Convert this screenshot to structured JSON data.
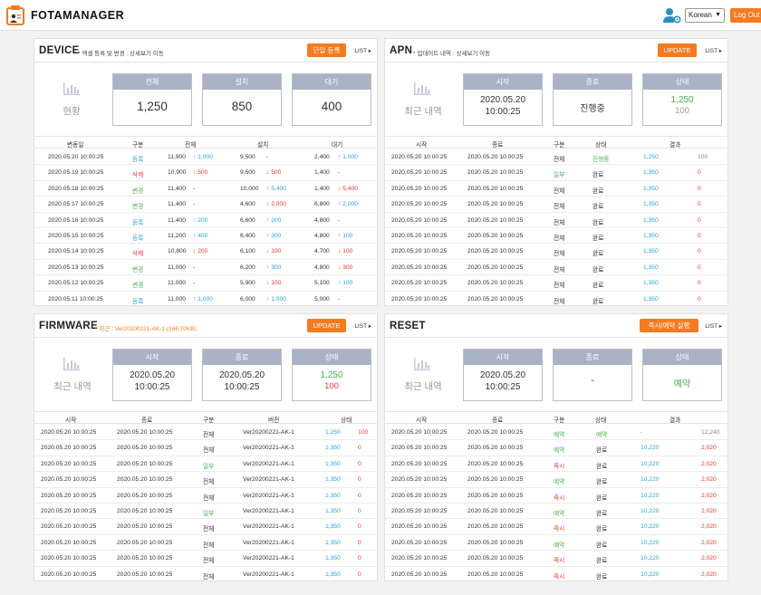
{
  "header": {
    "brand": "FOTAMANAGER",
    "lang": "Korean",
    "logout": "Log Out",
    "colors": {
      "accent": "#f57b20",
      "box_header": "#a9b3c5",
      "blue": "#2aa4d6",
      "red": "#e53935",
      "green": "#4caf50"
    }
  },
  "device": {
    "title": "DEVICE",
    "subtitle": "* 엑셀 등록 및 변경 : 상세보기 이동",
    "button": "단일 등록",
    "list": "LIST ▸",
    "summary_label": "현황",
    "boxes": [
      {
        "label": "전체",
        "value": "1,250"
      },
      {
        "label": "설치",
        "value": "850"
      },
      {
        "label": "대기",
        "value": "400"
      }
    ],
    "columns": [
      "변동일",
      "구분",
      "전체",
      "설치",
      "대기"
    ],
    "rows": [
      {
        "date": "2020.05.20 10:00:25",
        "type": "등록",
        "tc": "b",
        "total": "11,900",
        "td": "↑ 1,000",
        "tdc": "b",
        "inst": "9,500",
        "idl": "-",
        "idc": "n",
        "wait": "2,400",
        "wd": "↑ 1,000",
        "wdc": "b"
      },
      {
        "date": "2020.05.19 10:00:25",
        "type": "삭제",
        "tc": "r",
        "total": "10,900",
        "td": "↓ 500",
        "tdc": "r",
        "inst": "9,500",
        "idl": "↓ 500",
        "idc": "r",
        "wait": "1,400",
        "wd": "-",
        "wdc": "n"
      },
      {
        "date": "2020.05.18 10:00:25",
        "type": "변경",
        "tc": "g",
        "total": "11,400",
        "td": "-",
        "tdc": "n",
        "inst": "10,000",
        "idl": "↑ 5,400",
        "idc": "b",
        "wait": "1,400",
        "wd": "↓ 5,400",
        "wdc": "r"
      },
      {
        "date": "2020.05.17 10:00:25",
        "type": "변경",
        "tc": "g",
        "total": "11,400",
        "td": "-",
        "tdc": "n",
        "inst": "4,600",
        "idl": "↓ 2,000",
        "idc": "r",
        "wait": "6,800",
        "wd": "↑ 2,000",
        "wdc": "b"
      },
      {
        "date": "2020.05.16 10:00:25",
        "type": "등록",
        "tc": "b",
        "total": "11,400",
        "td": "↑ 200",
        "tdc": "b",
        "inst": "6,600",
        "idl": "↑ 200",
        "idc": "b",
        "wait": "4,800",
        "wd": "-",
        "wdc": "n"
      },
      {
        "date": "2020.05.15 10:00:25",
        "type": "등록",
        "tc": "b",
        "total": "11,200",
        "td": "↑ 400",
        "tdc": "b",
        "inst": "6,400",
        "idl": "↑ 300",
        "idc": "b",
        "wait": "4,800",
        "wd": "↑ 100",
        "wdc": "b"
      },
      {
        "date": "2020.05.14 10:00:25",
        "type": "삭제",
        "tc": "r",
        "total": "10,800",
        "td": "↓ 200",
        "tdc": "r",
        "inst": "6,100",
        "idl": "↓ 100",
        "idc": "r",
        "wait": "4,700",
        "wd": "↓ 100",
        "wdc": "r"
      },
      {
        "date": "2020.05.13 10:00:25",
        "type": "변경",
        "tc": "g",
        "total": "11,000",
        "td": "-",
        "tdc": "n",
        "inst": "6,200",
        "idl": "↑ 300",
        "idc": "b",
        "wait": "4,800",
        "wd": "↓ 300",
        "wdc": "r"
      },
      {
        "date": "2020.05.12 10:00:25",
        "type": "변경",
        "tc": "g",
        "total": "11,000",
        "td": "-",
        "tdc": "n",
        "inst": "5,900",
        "idl": "↓ 100",
        "idc": "r",
        "wait": "5,100",
        "wd": "↑ 100",
        "wdc": "b"
      },
      {
        "date": "2020.05.11 10:00:25",
        "type": "등록",
        "tc": "b",
        "total": "11,000",
        "td": "↑ 1,000",
        "tdc": "b",
        "inst": "6,000",
        "idl": "↑ 1,000",
        "idc": "b",
        "wait": "5,000",
        "wd": "-",
        "wdc": "n"
      }
    ]
  },
  "apn": {
    "title": "APN",
    "subtitle": "* 업데이트 내역 : 상세보기 이동",
    "button": "UPDATE",
    "list": "LIST ▸",
    "summary_label": "최근 내역",
    "boxes": [
      {
        "label": "시작",
        "date": "2020.05.20",
        "time": "10:00:25"
      },
      {
        "label": "종료",
        "value": "진행중"
      },
      {
        "label": "상태",
        "green": "1,250",
        "other": "100"
      }
    ],
    "columns": [
      "시작",
      "종료",
      "구분",
      "상태",
      "결과"
    ],
    "rows": [
      {
        "start": "2020.05.20 10:00:25",
        "end": "2020.05.20 10:00:25",
        "type": "전체",
        "tc": "n",
        "status": "진행중",
        "sc": "g",
        "ok": "1,250",
        "fail": "100",
        "fc": "gray"
      },
      {
        "start": "2020.05.20 10:00:25",
        "end": "2020.05.20 10:00:25",
        "type": "일부",
        "tc": "g",
        "status": "완료",
        "sc": "n",
        "ok": "1,350",
        "fail": "0",
        "fc": "r"
      },
      {
        "start": "2020.05.20 10:00:25",
        "end": "2020.05.20 10:00:25",
        "type": "전체",
        "tc": "n",
        "status": "완료",
        "sc": "n",
        "ok": "1,350",
        "fail": "0",
        "fc": "r"
      },
      {
        "start": "2020.05.20 10:00:25",
        "end": "2020.05.20 10:00:25",
        "type": "전체",
        "tc": "n",
        "status": "완료",
        "sc": "n",
        "ok": "1,350",
        "fail": "0",
        "fc": "r"
      },
      {
        "start": "2020.05.20 10:00:25",
        "end": "2020.05.20 10:00:25",
        "type": "전체",
        "tc": "n",
        "status": "완료",
        "sc": "n",
        "ok": "1,350",
        "fail": "0",
        "fc": "r"
      },
      {
        "start": "2020.05.20 10:00:25",
        "end": "2020.05.20 10:00:25",
        "type": "전체",
        "tc": "n",
        "status": "완료",
        "sc": "n",
        "ok": "1,350",
        "fail": "0",
        "fc": "r"
      },
      {
        "start": "2020.05.20 10:00:25",
        "end": "2020.05.20 10:00:25",
        "type": "전체",
        "tc": "n",
        "status": "완료",
        "sc": "n",
        "ok": "1,350",
        "fail": "0",
        "fc": "r"
      },
      {
        "start": "2020.05.20 10:00:25",
        "end": "2020.05.20 10:00:25",
        "type": "전체",
        "tc": "n",
        "status": "완료",
        "sc": "n",
        "ok": "1,350",
        "fail": "0",
        "fc": "r"
      },
      {
        "start": "2020.05.20 10:00:25",
        "end": "2020.05.20 10:00:25",
        "type": "전체",
        "tc": "n",
        "status": "완료",
        "sc": "n",
        "ok": "1,350",
        "fail": "0",
        "fc": "r"
      },
      {
        "start": "2020.05.20 10:00:25",
        "end": "2020.05.20 10:00:25",
        "type": "전체",
        "tc": "n",
        "status": "완료",
        "sc": "n",
        "ok": "1,350",
        "fail": "0",
        "fc": "r"
      }
    ]
  },
  "firmware": {
    "title": "FIRMWARE",
    "subtitle": "* 최근 : Ver20200221-AK-1 (166.70KB)",
    "button": "UPDATE",
    "list": "LIST ▸",
    "summary_label": "최근 내역",
    "boxes": [
      {
        "label": "시작",
        "date": "2020.05.20",
        "time": "10:00:25"
      },
      {
        "label": "종료",
        "date": "2020.05.20",
        "time": "10:00:25"
      },
      {
        "label": "상태",
        "green": "1,250",
        "red": "100"
      }
    ],
    "columns": [
      "시작",
      "종료",
      "구분",
      "버전",
      "상태"
    ],
    "rows": [
      {
        "start": "2020.05.20 10:00:25",
        "end": "2020.05.20 10:00:25",
        "type": "전체",
        "tc": "n",
        "ver": "Ver20200221-AK-1",
        "ok": "1,250",
        "fail": "100"
      },
      {
        "start": "2020.05.20 10:00:25",
        "end": "2020.05.20 10:00:25",
        "type": "전체",
        "tc": "n",
        "ver": "Ver20200221-AK-1",
        "ok": "1,350",
        "fail": "0"
      },
      {
        "start": "2020.05.20 10:00:25",
        "end": "2020.05.20 10:00:25",
        "type": "일부",
        "tc": "g",
        "ver": "Ver20200221-AK-1",
        "ok": "1,350",
        "fail": "0"
      },
      {
        "start": "2020.05.20 10:00:25",
        "end": "2020.05.20 10:00:25",
        "type": "전체",
        "tc": "n",
        "ver": "Ver20200221-AK-1",
        "ok": "1,350",
        "fail": "0"
      },
      {
        "start": "2020.05.20 10:00:25",
        "end": "2020.05.20 10:00:25",
        "type": "전체",
        "tc": "n",
        "ver": "Ver20200221-AK-1",
        "ok": "1,350",
        "fail": "0"
      },
      {
        "start": "2020.05.20 10:00:25",
        "end": "2020.05.20 10:00:25",
        "type": "일부",
        "tc": "g",
        "ver": "Ver20200221-AK-1",
        "ok": "1,350",
        "fail": "0"
      },
      {
        "start": "2020.05.20 10:00:25",
        "end": "2020.05.20 10:00:25",
        "type": "전체",
        "tc": "n",
        "ver": "Ver20200221-AK-1",
        "ok": "1,350",
        "fail": "0"
      },
      {
        "start": "2020.05.20 10:00:25",
        "end": "2020.05.20 10:00:25",
        "type": "전체",
        "tc": "n",
        "ver": "Ver20200221-AK-1",
        "ok": "1,350",
        "fail": "0"
      },
      {
        "start": "2020.05.20 10:00:25",
        "end": "2020.05.20 10:00:25",
        "type": "전체",
        "tc": "n",
        "ver": "Ver20200221-AK-1",
        "ok": "1,350",
        "fail": "0"
      },
      {
        "start": "2020.05.20 10:00:25",
        "end": "2020.05.20 10:00:25",
        "type": "전체",
        "tc": "n",
        "ver": "Ver20200221-AK-1",
        "ok": "1,350",
        "fail": "0"
      }
    ]
  },
  "reset": {
    "title": "RESET",
    "subtitle": "",
    "button": "즉시/예약 실행",
    "list": "LIST ▸",
    "summary_label": "최근 내역",
    "boxes": [
      {
        "label": "시작",
        "date": "2020.05.20",
        "time": "10:00:25"
      },
      {
        "label": "종료",
        "value": "-"
      },
      {
        "label": "상태",
        "value": "예약"
      }
    ],
    "columns": [
      "시작",
      "종료",
      "구분",
      "상태",
      "결과"
    ],
    "rows": [
      {
        "start": "2020.05.20 10:00:25",
        "end": "2020.05.20 10:00:25",
        "type": "예약",
        "tc": "g",
        "status": "예약",
        "sc": "g",
        "ok": "-",
        "okc": "g",
        "fail": "12,240",
        "fc": "gray"
      },
      {
        "start": "2020.05.20 10:00:25",
        "end": "2020.05.20 10:00:25",
        "type": "예약",
        "tc": "g",
        "status": "완료",
        "sc": "n",
        "ok": "10,220",
        "okc": "b",
        "fail": "2,020",
        "fc": "r"
      },
      {
        "start": "2020.05.20 10:00:25",
        "end": "2020.05.20 10:00:25",
        "type": "즉시",
        "tc": "r",
        "status": "완료",
        "sc": "n",
        "ok": "10,220",
        "okc": "b",
        "fail": "2,020",
        "fc": "r"
      },
      {
        "start": "2020.05.20 10:00:25",
        "end": "2020.05.20 10:00:25",
        "type": "예약",
        "tc": "g",
        "status": "완료",
        "sc": "n",
        "ok": "10,220",
        "okc": "b",
        "fail": "2,020",
        "fc": "r"
      },
      {
        "start": "2020.05.20 10:00:25",
        "end": "2020.05.20 10:00:25",
        "type": "즉시",
        "tc": "r",
        "status": "완료",
        "sc": "n",
        "ok": "10,220",
        "okc": "b",
        "fail": "2,020",
        "fc": "r"
      },
      {
        "start": "2020.05.20 10:00:25",
        "end": "2020.05.20 10:00:25",
        "type": "예약",
        "tc": "g",
        "status": "완료",
        "sc": "n",
        "ok": "10,220",
        "okc": "b",
        "fail": "2,020",
        "fc": "r"
      },
      {
        "start": "2020.05.20 10:00:25",
        "end": "2020.05.20 10:00:25",
        "type": "즉시",
        "tc": "r",
        "status": "완료",
        "sc": "n",
        "ok": "10,220",
        "okc": "b",
        "fail": "2,020",
        "fc": "r"
      },
      {
        "start": "2020.05.20 10:00:25",
        "end": "2020.05.20 10:00:25",
        "type": "예약",
        "tc": "g",
        "status": "완료",
        "sc": "n",
        "ok": "10,220",
        "okc": "b",
        "fail": "2,020",
        "fc": "r"
      },
      {
        "start": "2020.05.20 10:00:25",
        "end": "2020.05.20 10:00:25",
        "type": "즉시",
        "tc": "r",
        "status": "완료",
        "sc": "n",
        "ok": "10,220",
        "okc": "b",
        "fail": "2,020",
        "fc": "r"
      },
      {
        "start": "2020.05.20 10:00:25",
        "end": "2020.05.20 10:00:25",
        "type": "즉시",
        "tc": "r",
        "status": "완료",
        "sc": "n",
        "ok": "10,220",
        "okc": "b",
        "fail": "2,020",
        "fc": "r"
      }
    ]
  }
}
